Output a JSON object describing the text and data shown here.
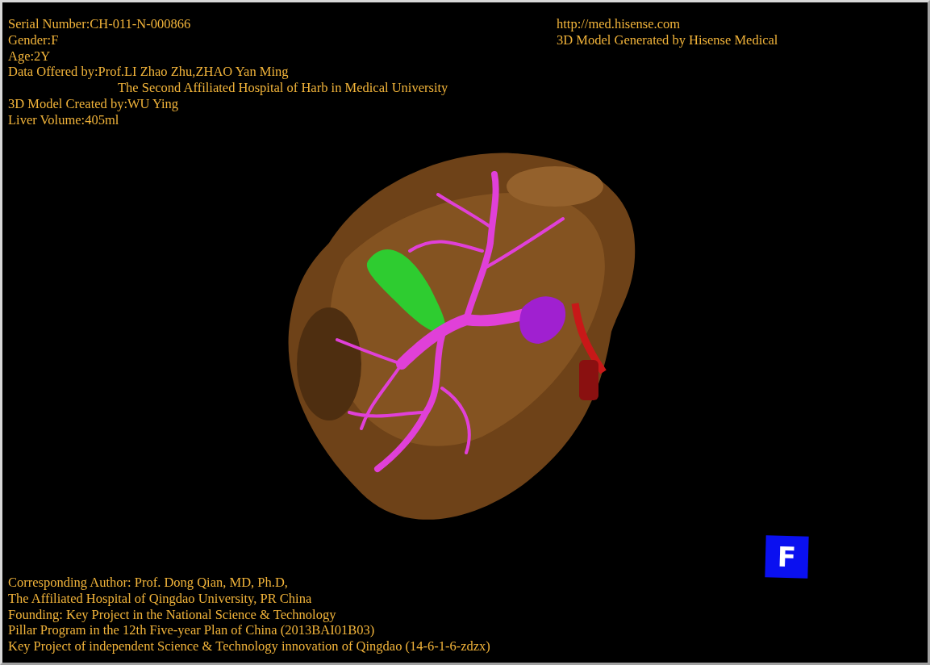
{
  "case_info": [
    {
      "kind": "line",
      "text": "Serial Number:CH-011-N-000866"
    },
    {
      "kind": "line",
      "text": "Gender:F"
    },
    {
      "kind": "line",
      "text": "Age:2Y"
    },
    {
      "kind": "line",
      "text": "Data Offered by:Prof.LI Zhao Zhu,ZHAO Yan Ming"
    },
    {
      "kind": "continuation",
      "text": "The Second Affiliated Hospital of Harb in Medical University"
    },
    {
      "kind": "line",
      "text": "3D Model Created by:WU Ying"
    },
    {
      "kind": "line",
      "text": "Liver Volume:405ml"
    }
  ],
  "source": [
    "http://med.hisense.com",
    "3D Model Generated by Hisense Medical"
  ],
  "credits": [
    "Corresponding Author: Prof. Dong Qian, MD, Ph.D,",
    "The Affiliated Hospital of Qingdao University, PR China",
    "Founding: Key Project in the National Science & Technology",
    "Pillar Program in the 12th Five-year Plan of China (2013BAI01B03)",
    "Key Project of independent Science & Technology innovation of Qingdao (14-6-1-6-zdzx)"
  ],
  "orientation_cube": {
    "label": "F"
  }
}
